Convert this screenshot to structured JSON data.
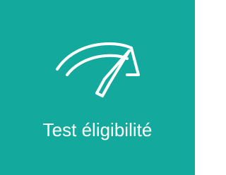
{
  "tile": {
    "label": "Test éligibilité",
    "icon": "gauge-icon",
    "background_color": "#13a99d",
    "foreground_color": "#ffffff"
  }
}
